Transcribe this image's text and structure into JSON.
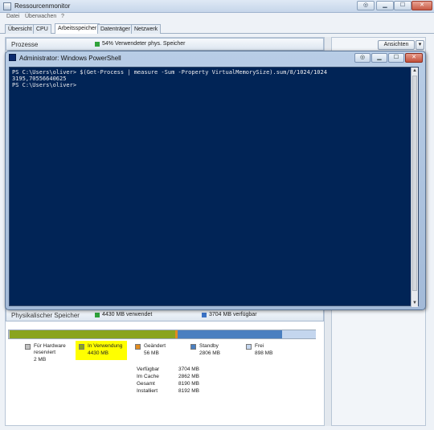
{
  "resmon": {
    "title": "Ressourcenmonitor",
    "menu": [
      "Datei",
      "Überwachen",
      "?"
    ],
    "tabs": [
      "Übersicht",
      "CPU",
      "Arbeitsspeicher",
      "Datenträger",
      "Netzwerk"
    ],
    "active_tab": "Arbeitsspeicher",
    "processes_header": "Prozesse",
    "processes_stat": "54% Verwendeter phys. Speicher",
    "view_button": "Ansichten",
    "physical_header": "Physikalischer Speicher",
    "physical_in_use": "4430 MB verwendet",
    "physical_available": "3704 MB verfügbar",
    "memory_bar": {
      "hardware_mb": 2,
      "in_use_mb": 4430,
      "modified_mb": 56,
      "standby_mb": 2806,
      "free_mb": 898,
      "total_mb": 8192
    },
    "legend": [
      {
        "label": "Für Hardware reserviert",
        "label_line1": "Für Hardware",
        "label_line2": "reserviert",
        "value": "2 MB",
        "color": "#c0c0c0"
      },
      {
        "label": "In Verwendung",
        "value": "4430 MB",
        "color": "#8aa41e",
        "highlighted": true
      },
      {
        "label": "Geändert",
        "value": "56 MB",
        "color": "#e28c1f"
      },
      {
        "label": "Standby",
        "value": "2806 MB",
        "color": "#4a7fc0"
      },
      {
        "label": "Frei",
        "value": "898 MB",
        "color": "#c4d6ee"
      }
    ],
    "stats": [
      {
        "label": "Verfügbar",
        "value": "3704 MB"
      },
      {
        "label": "Im Cache",
        "value": "2862 MB"
      },
      {
        "label": "Gesamt",
        "value": "8190 MB"
      },
      {
        "label": "Installiert",
        "value": "8192 MB"
      }
    ]
  },
  "powershell": {
    "title": "Administrator: Windows PowerShell",
    "lines": [
      "PS C:\\Users\\oliver> $(Get-Process | measure -Sum -Property VirtualMemorySize).sum/8/1024/1024",
      "3195,70556640625",
      "PS C:\\Users\\oliver>"
    ]
  },
  "colors": {
    "console_bg": "#012456",
    "console_text": "#eeedf0",
    "highlight": "#ffff00"
  }
}
